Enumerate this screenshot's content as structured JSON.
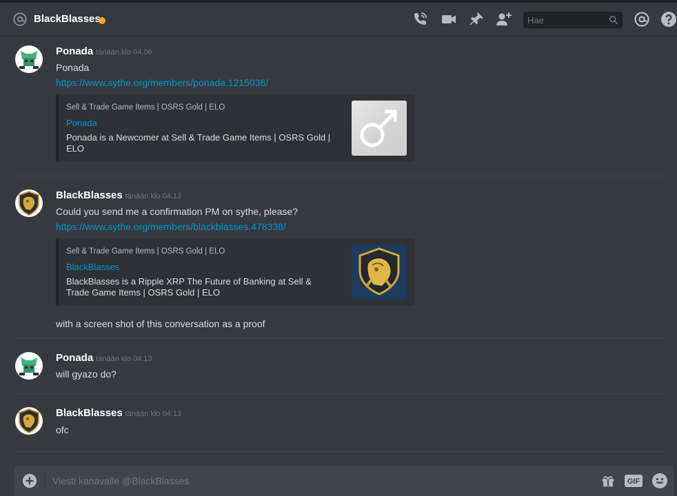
{
  "header": {
    "channel_name": "BlackBlasses",
    "status_color": "#faa61a",
    "icons": [
      "at-icon",
      "call-icon",
      "video-icon",
      "pin-icon",
      "add-friend-icon",
      "mention-icon",
      "help-icon"
    ],
    "search_placeholder": "Hae"
  },
  "messages": [
    {
      "author": "Ponada",
      "timestamp": "tänään klo 04.06",
      "lines": [
        "Ponada"
      ],
      "link": "https://www.sythe.org/members/ponada.1215036/",
      "embed": {
        "provider": "Sell & Trade Game Items | OSRS Gold | ELO",
        "title": "Ponada",
        "description": "Ponada is a Newcomer at Sell & Trade Game Items | OSRS Gold | ELO",
        "thumbnail": "male-symbol-icon"
      }
    },
    {
      "author": "BlackBlasses",
      "timestamp": "tänään klo 04.13",
      "lines": [
        "Could you send me a confirmation PM on sythe, please?",
        "with a screen shot of this conversation as a proof"
      ],
      "link": "https://www.sythe.org/members/blackblasses.478338/",
      "embed": {
        "provider": "Sell & Trade Game Items | OSRS Gold | ELO",
        "title": "BlackBlasses",
        "description": "BlackBlasses is a Ripple XRP The Future of Banking at Sell & Trade Game Items | OSRS Gold | ELO",
        "thumbnail": "gold-lion-crest-icon"
      }
    },
    {
      "author": "Ponada",
      "timestamp": "tänään klo 04.13",
      "lines": [
        "will gyazo do?"
      ]
    },
    {
      "author": "BlackBlasses",
      "timestamp": "tänään klo 04.13",
      "lines": [
        "ofc"
      ]
    }
  ],
  "composer": {
    "placeholder": "Viesti kanavalle @BlackBlasses",
    "gif_label": "GIF",
    "icons": [
      "plus-icon",
      "gift-icon",
      "gif-icon",
      "emoji-icon"
    ]
  }
}
